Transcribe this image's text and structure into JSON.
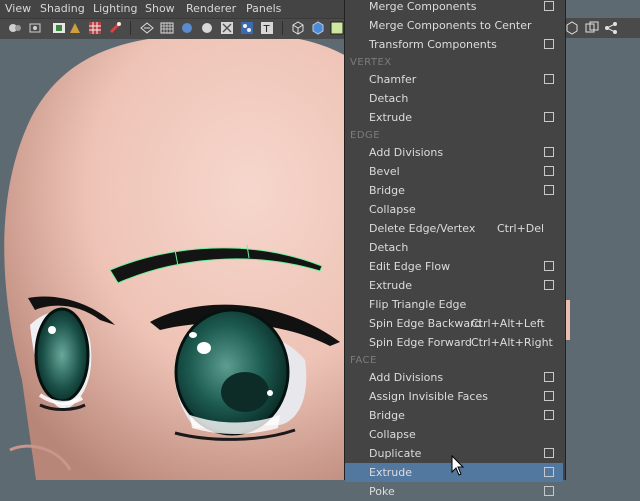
{
  "menubar": {
    "items": [
      "View",
      "Shading",
      "Lighting",
      "Show",
      "Renderer",
      "Panels"
    ]
  },
  "toolbar": {
    "icons": [
      "camera-icon",
      "bookmark-icon",
      "film-gate-icon",
      "resolution-gate-icon",
      "grid-icon",
      "wireframe-icon",
      "smooth-shade-icon",
      "textured-icon",
      "lights-icon",
      "shadows-icon",
      "xray-icon",
      "isolate-icon",
      "texture-icon",
      "cube-icon",
      "shaded-cube-icon"
    ]
  },
  "colors": {
    "menu_bg": "#444444",
    "highlight": "#5278a0",
    "section_text": "#7c7c7c",
    "skin": "#f0c8bd",
    "iris": "#0f3b34",
    "viewport_bg": "#5e6a72"
  },
  "marking_menu": {
    "top_items": [
      {
        "label": "Merge Components",
        "option_box": true
      },
      {
        "label": "Merge Components to Center",
        "option_box": false
      },
      {
        "label": "Transform Components",
        "option_box": true
      }
    ],
    "sections": [
      {
        "title": "VERTEX",
        "items": [
          {
            "label": "Chamfer",
            "option_box": true
          },
          {
            "label": "Detach",
            "option_box": false
          },
          {
            "label": "Extrude",
            "option_box": true
          }
        ]
      },
      {
        "title": "EDGE",
        "items": [
          {
            "label": "Add Divisions",
            "option_box": true
          },
          {
            "label": "Bevel",
            "option_box": true
          },
          {
            "label": "Bridge",
            "option_box": true
          },
          {
            "label": "Collapse",
            "option_box": false
          },
          {
            "label": "Delete Edge/Vertex",
            "shortcut": "Ctrl+Del",
            "option_box": false
          },
          {
            "label": "Detach",
            "option_box": false
          },
          {
            "label": "Edit Edge Flow",
            "option_box": true
          },
          {
            "label": "Extrude",
            "option_box": true
          },
          {
            "label": "Flip Triangle Edge",
            "option_box": false
          },
          {
            "label": "Spin Edge Backward",
            "shortcut": "Ctrl+Alt+Left",
            "option_box": false
          },
          {
            "label": "Spin Edge Forward",
            "shortcut": "Ctrl+Alt+Right",
            "option_box": false
          }
        ]
      },
      {
        "title": "FACE",
        "items": [
          {
            "label": "Add Divisions",
            "option_box": true
          },
          {
            "label": "Assign Invisible Faces",
            "option_box": true
          },
          {
            "label": "Bridge",
            "option_box": true
          },
          {
            "label": "Collapse",
            "option_box": false
          },
          {
            "label": "Duplicate",
            "option_box": true
          },
          {
            "label": "Extrude",
            "option_box": true,
            "highlighted": true
          },
          {
            "label": "Poke",
            "option_box": true
          }
        ]
      }
    ]
  }
}
